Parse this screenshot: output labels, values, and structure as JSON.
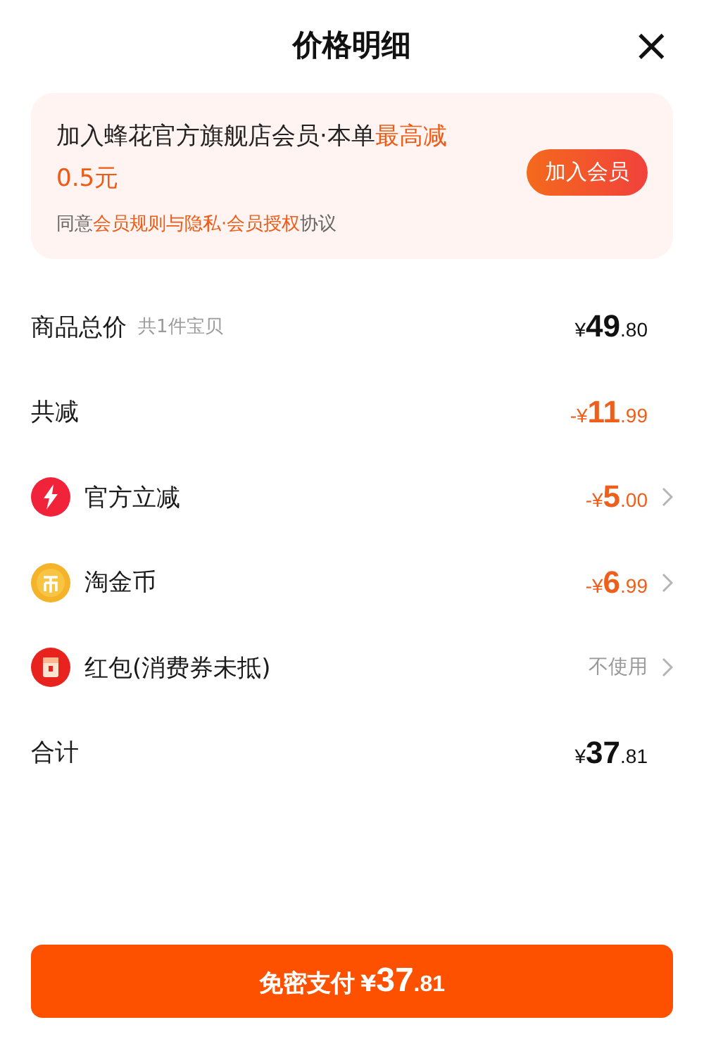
{
  "title": "价格明细",
  "close": "×",
  "promo": {
    "headline": [
      {
        "text": "加入蜂花官方旗舰店会员·本单",
        "highlight": false
      },
      {
        "text": "最高减0.5元",
        "highlight": true
      }
    ],
    "agreement": [
      {
        "text": "同意",
        "link": false
      },
      {
        "text": "会员规则与隐私·会员授权",
        "link": true
      },
      {
        "text": "协议",
        "link": false
      }
    ],
    "button": "加入会员"
  },
  "rows": [
    {
      "kind": "subtotal",
      "label": "商品总价",
      "note": "共1件宝贝",
      "price": {
        "currency": "¥",
        "int": "49",
        "dec": ".80"
      },
      "chevron": false
    },
    {
      "kind": "reduction",
      "label": "共减",
      "price": {
        "sign": "-",
        "currency": "¥",
        "int": "11",
        "dec": ".99"
      },
      "chevron": false
    },
    {
      "kind": "instant",
      "label": "官方立减",
      "price": {
        "sign": "-",
        "currency": "¥",
        "int": "5",
        "dec": ".00"
      },
      "chevron": true
    },
    {
      "kind": "coins",
      "label": "淘金币",
      "price": {
        "sign": "-",
        "currency": "¥",
        "int": "6",
        "dec": ".99"
      },
      "chevron": true
    },
    {
      "kind": "voucher",
      "label": "红包(消费券未抵)",
      "value": "不使用",
      "chevron": true
    },
    {
      "kind": "total",
      "label": "合计",
      "price": {
        "currency": "¥",
        "int": "37",
        "dec": ".81"
      },
      "chevron": false
    }
  ],
  "pay": {
    "label": "免密支付",
    "currency": "¥",
    "int": "37",
    "dec": ".81"
  }
}
